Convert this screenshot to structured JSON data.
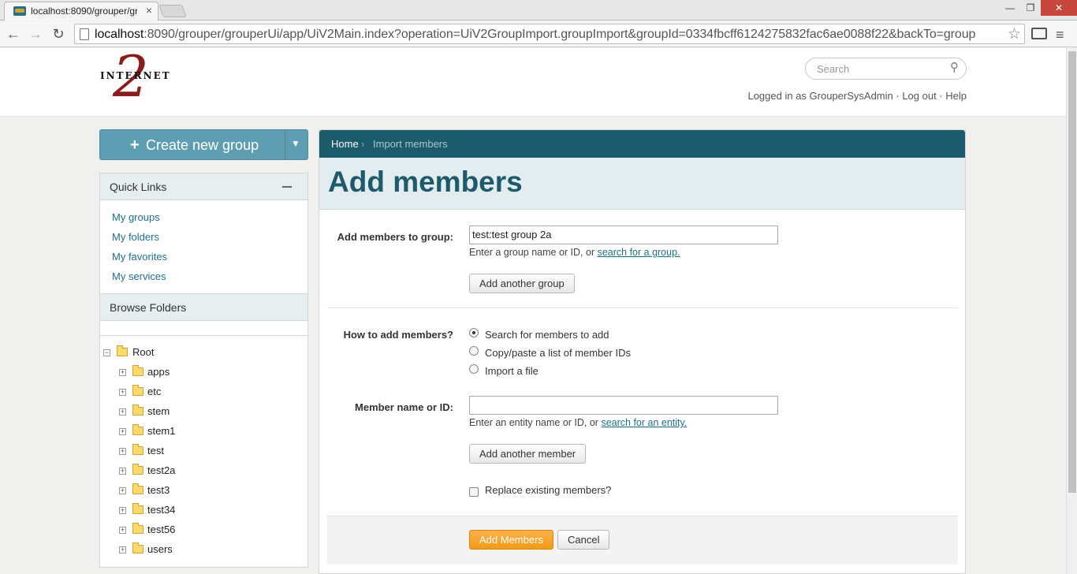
{
  "browser": {
    "tab_title": "localhost:8090/grouper/gr",
    "tab_close": "×",
    "url_host": "localhost",
    "url_rest": ":8090/grouper/grouperUi/app/UiV2Main.index?operation=UiV2GroupImport.groupImport&groupId=0334fbcff6124275832fac6ae0088f22&backTo=group",
    "win_min": "—",
    "win_max": "❐",
    "win_close": "✕"
  },
  "header": {
    "logo_text": "INTERNET",
    "logo_mark": "2",
    "search_placeholder": "Search",
    "logged_in": "Logged in as GrouperSysAdmin",
    "sep1": " · ",
    "logout": "Log out",
    "sep2": " · ",
    "help": "Help"
  },
  "sidebar": {
    "create_label": "Create new group",
    "quick_links_title": "Quick Links",
    "quick_links": [
      "My groups",
      "My folders",
      "My favorites",
      "My services"
    ],
    "browse_title": "Browse Folders",
    "tree_root": "Root",
    "tree_children": [
      "apps",
      "etc",
      "stem",
      "stem1",
      "test",
      "test2a",
      "test3",
      "test34",
      "test56",
      "users"
    ]
  },
  "breadcrumb": {
    "home": "Home",
    "sep": "›",
    "current": "Import members"
  },
  "main": {
    "title": "Add members",
    "group_label": "Add members to group:",
    "group_value": "test:test group 2a",
    "group_help_prefix": "Enter a group name or ID, or ",
    "group_help_link": "search for a group.",
    "add_group_btn": "Add another group",
    "how_label": "How to add members?",
    "options": [
      "Search for members to add",
      "Copy/paste a list of member IDs",
      "Import a file"
    ],
    "selected_option": 0,
    "member_label": "Member name or ID:",
    "member_value": "",
    "member_help_prefix": "Enter an entity name or ID, or ",
    "member_help_link": "search for an entity.",
    "add_member_btn": "Add another member",
    "replace_label": "Replace existing members?",
    "replace_checked": false,
    "submit_btn": "Add Members",
    "cancel_btn": "Cancel"
  }
}
